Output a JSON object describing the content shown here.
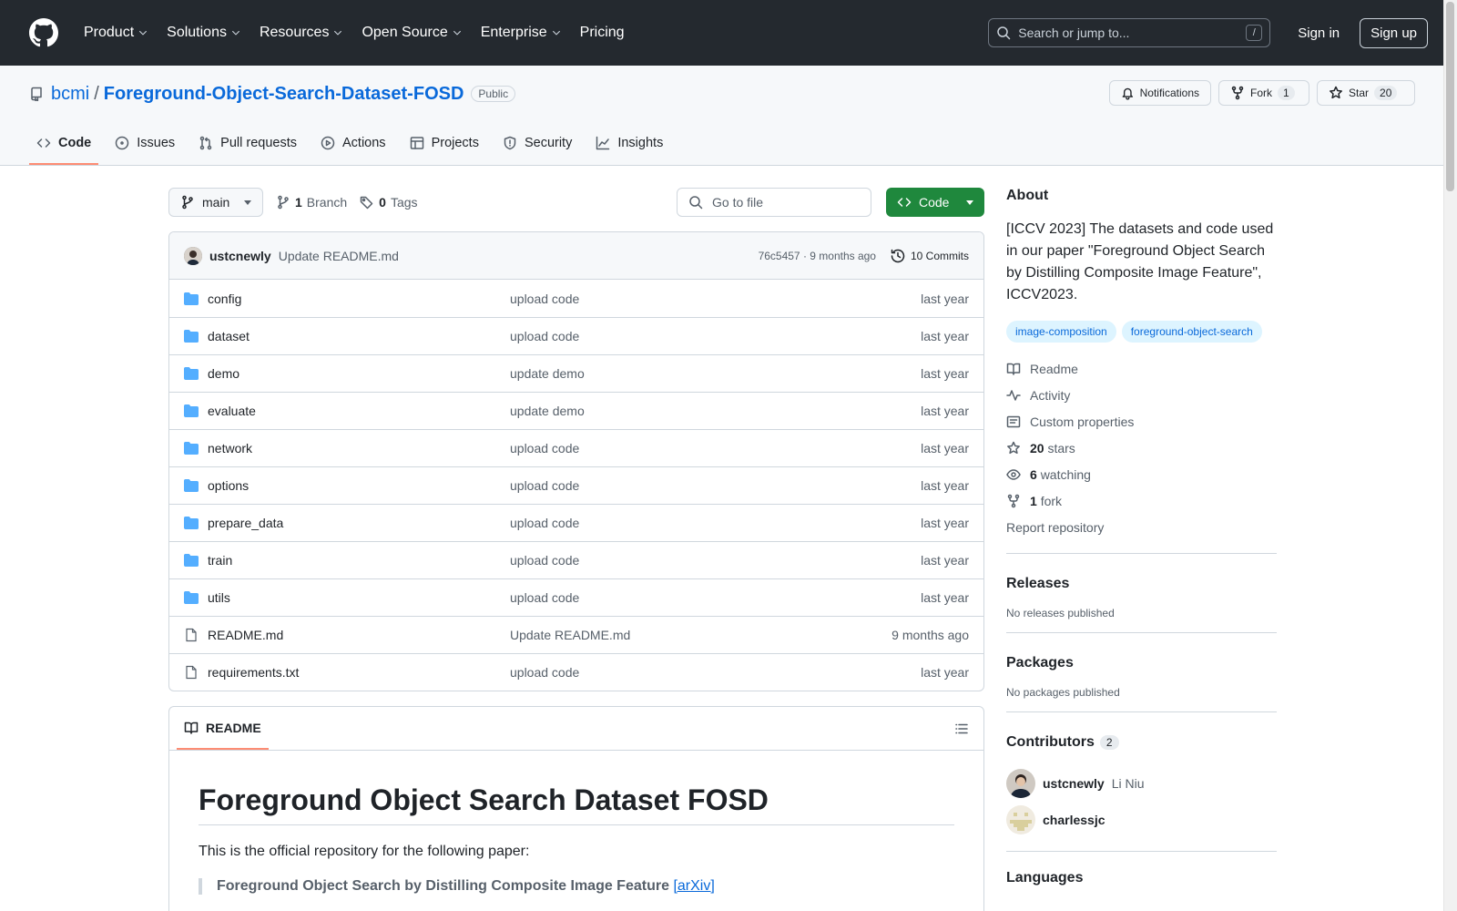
{
  "header": {
    "nav": [
      {
        "label": "Product",
        "dropdown": true
      },
      {
        "label": "Solutions",
        "dropdown": true
      },
      {
        "label": "Resources",
        "dropdown": true
      },
      {
        "label": "Open Source",
        "dropdown": true
      },
      {
        "label": "Enterprise",
        "dropdown": true
      },
      {
        "label": "Pricing",
        "dropdown": false
      }
    ],
    "search_placeholder": "Search or jump to...",
    "search_shortcut": "/",
    "signin": "Sign in",
    "signup": "Sign up"
  },
  "repo": {
    "owner": "bcmi",
    "separator": "/",
    "name": "Foreground-Object-Search-Dataset-FOSD",
    "visibility": "Public",
    "notifications_label": "Notifications",
    "fork_label": "Fork",
    "fork_count": "1",
    "star_label": "Star",
    "star_count": "20",
    "tabs": [
      {
        "label": "Code",
        "icon": "code-icon",
        "active": true
      },
      {
        "label": "Issues",
        "icon": "issue-icon",
        "active": false
      },
      {
        "label": "Pull requests",
        "icon": "pull-request-icon",
        "active": false
      },
      {
        "label": "Actions",
        "icon": "play-icon",
        "active": false
      },
      {
        "label": "Projects",
        "icon": "table-icon",
        "active": false
      },
      {
        "label": "Security",
        "icon": "shield-icon",
        "active": false
      },
      {
        "label": "Insights",
        "icon": "graph-icon",
        "active": false
      }
    ]
  },
  "toolbar": {
    "branch": "main",
    "branch_count": "1",
    "branch_label": "Branch",
    "tag_count": "0",
    "tag_label": "Tags",
    "goto_placeholder": "Go to file",
    "code_button": "Code"
  },
  "commit": {
    "author": "ustcnewly",
    "message": "Update README.md",
    "sha_time": "76c5457 · 9 months ago",
    "commits": "10 Commits"
  },
  "files": [
    {
      "name": "config",
      "type": "dir",
      "message": "upload code",
      "date": "last year"
    },
    {
      "name": "dataset",
      "type": "dir",
      "message": "upload code",
      "date": "last year"
    },
    {
      "name": "demo",
      "type": "dir",
      "message": "update demo",
      "date": "last year"
    },
    {
      "name": "evaluate",
      "type": "dir",
      "message": "update demo",
      "date": "last year"
    },
    {
      "name": "network",
      "type": "dir",
      "message": "upload code",
      "date": "last year"
    },
    {
      "name": "options",
      "type": "dir",
      "message": "upload code",
      "date": "last year"
    },
    {
      "name": "prepare_data",
      "type": "dir",
      "message": "upload code",
      "date": "last year"
    },
    {
      "name": "train",
      "type": "dir",
      "message": "upload code",
      "date": "last year"
    },
    {
      "name": "utils",
      "type": "dir",
      "message": "upload code",
      "date": "last year"
    },
    {
      "name": "README.md",
      "type": "file",
      "message": "Update README.md",
      "date": "9 months ago"
    },
    {
      "name": "requirements.txt",
      "type": "file",
      "message": "upload code",
      "date": "last year"
    }
  ],
  "readme": {
    "tab_label": "README",
    "title": "Foreground Object Search Dataset FOSD",
    "intro": "This is the official repository for the following paper:",
    "quote": "Foreground Object Search by Distilling Composite Image Feature",
    "quote_link": "[arXiv]"
  },
  "about": {
    "heading": "About",
    "description": "[ICCV 2023] The datasets and code used in our paper \"Foreground Object Search by Distilling Composite Image Feature\", ICCV2023.",
    "topics": [
      "image-composition",
      "foreground-object-search"
    ],
    "links": [
      {
        "icon": "book-icon",
        "bold": "",
        "label": "Readme"
      },
      {
        "icon": "pulse-icon",
        "bold": "",
        "label": "Activity"
      },
      {
        "icon": "note-icon",
        "bold": "",
        "label": "Custom properties"
      },
      {
        "icon": "star-icon",
        "bold": "20",
        "label": "stars"
      },
      {
        "icon": "eye-icon",
        "bold": "6",
        "label": "watching"
      },
      {
        "icon": "fork-icon",
        "bold": "1",
        "label": "fork"
      }
    ],
    "report": "Report repository"
  },
  "releases": {
    "heading": "Releases",
    "text": "No releases published"
  },
  "packages": {
    "heading": "Packages",
    "text": "No packages published"
  },
  "contributors": {
    "heading": "Contributors",
    "count": "2",
    "people": [
      {
        "login": "ustcnewly",
        "name": "Li Niu"
      },
      {
        "login": "charlessjc",
        "name": ""
      }
    ]
  },
  "languages": {
    "heading": "Languages"
  },
  "colors": {
    "accent": "#0969da",
    "green": "#1f883d",
    "header_bg": "#24292f",
    "tab_underline": "#fd8c73",
    "folder": "#54aeff"
  }
}
